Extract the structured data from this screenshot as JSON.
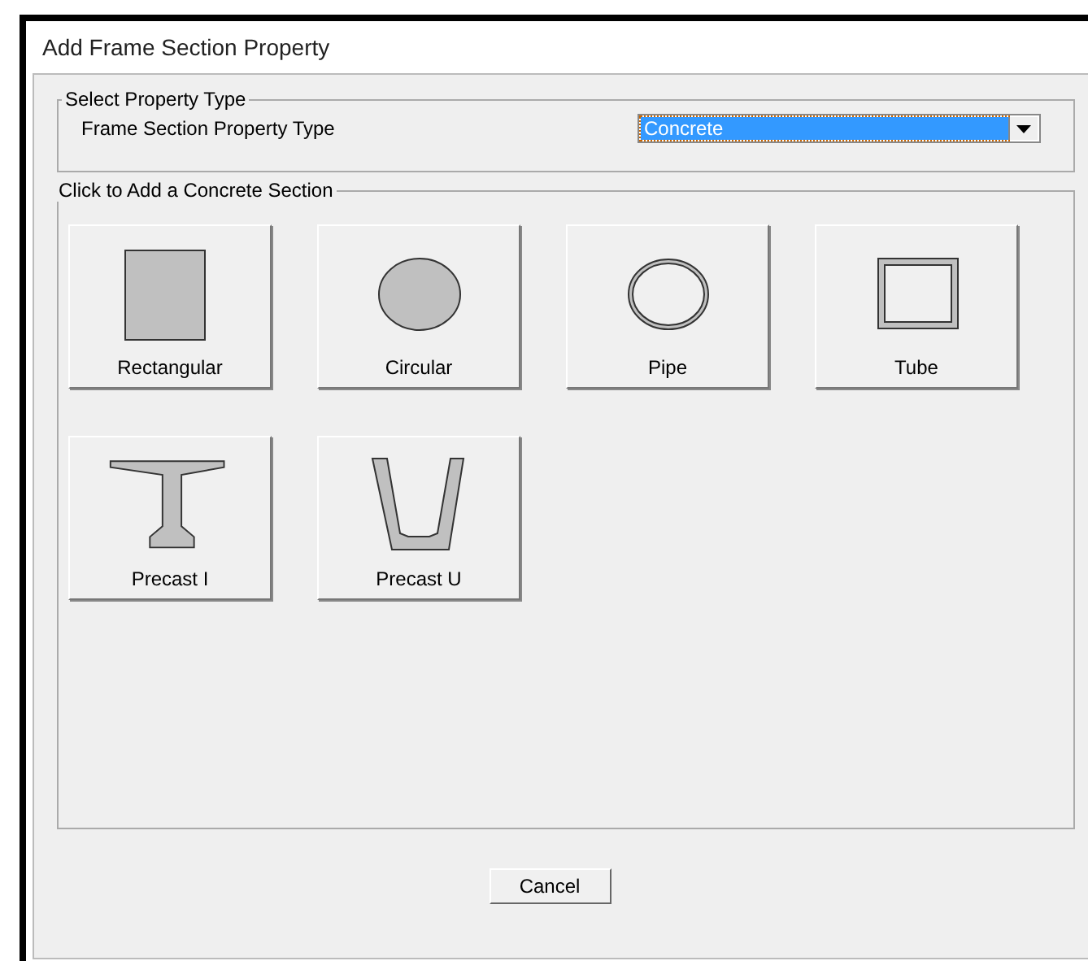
{
  "window": {
    "title": "Add Frame Section Property"
  },
  "property_type_group": {
    "legend": "Select Property Type",
    "label": "Frame Section Property Type",
    "dropdown": {
      "value": "Concrete"
    }
  },
  "sections_group": {
    "legend": "Click to Add a Concrete Section",
    "buttons": [
      {
        "label": "Rectangular",
        "kind": "rectangle"
      },
      {
        "label": "Circular",
        "kind": "circle"
      },
      {
        "label": "Pipe",
        "kind": "pipe"
      },
      {
        "label": "Tube",
        "kind": "tube"
      },
      {
        "label": "Precast I",
        "kind": "i-beam"
      },
      {
        "label": "Precast U",
        "kind": "u-channel"
      }
    ]
  },
  "buttons": [
    "Cancel"
  ]
}
